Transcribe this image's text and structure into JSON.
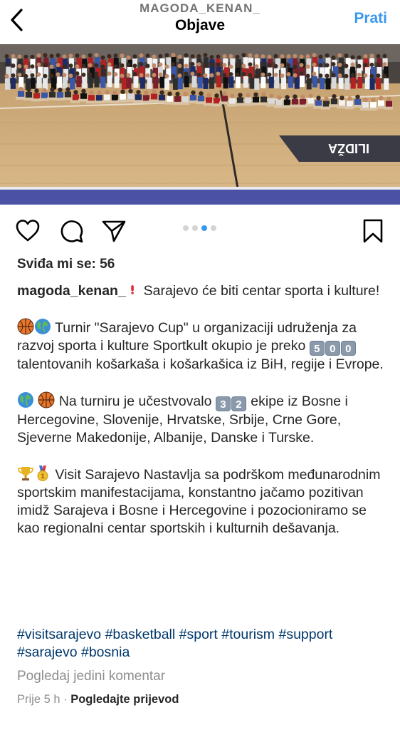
{
  "header": {
    "username": "MAGODA_KENAN_",
    "title": "Objave",
    "follow_label": "Prati"
  },
  "post": {
    "likes_text": "Sviđa mi se: 56",
    "carousel": {
      "count": 4,
      "active_index": 2
    },
    "caption": {
      "username": "magoda_kenan_",
      "p1_text": " Sarajevo će biti centar sporta i kulture!",
      "p2_text1": " Turnir \"Sarajevo Cup\" u organizaciji udruženja za razvoj sporta i kulture Sportkult okupio je preko ",
      "p2_digits": [
        "5",
        "0",
        "0"
      ],
      "p2_text2": " talentovanih košarkaša i košarkašica iz BiH, regije i Evrope.",
      "p3_text1": " Na turniru je učestvovalo ",
      "p3_digits": [
        "3",
        "2"
      ],
      "p3_text2": " ekipe iz Bosne i Hercegovine, Slovenije, Hrvatske, Srbije, Crne Gore, Sjeverne Makedonije, Albanije, Danske i Turske.",
      "p4_text": " Visit Sarajevo Nastavlja sa podrškom međunarodnim sportskim manifestacijama, konstantno jačamo pozitivan imidž Sarajeva i Bosne i Hercegovine i pozocioniramo se kao regionalni centar sportskih i kulturnih dešavanja."
    },
    "hashtags": [
      "#visitsarajevo",
      "#basketball",
      "#sport",
      "#tourism",
      "#support",
      "#sarajevo",
      "#bosnia"
    ],
    "comments_link": "Pogledaj jedini komentar",
    "time": "Prije 5 h",
    "separator": "·",
    "translate_label": "Pogledajte prijevod"
  },
  "photo": {
    "court_logo_text": "ILIDŽA"
  },
  "colors": {
    "accent": "#3897f0",
    "hashtag": "#00376b",
    "muted": "#8e8e8e"
  }
}
